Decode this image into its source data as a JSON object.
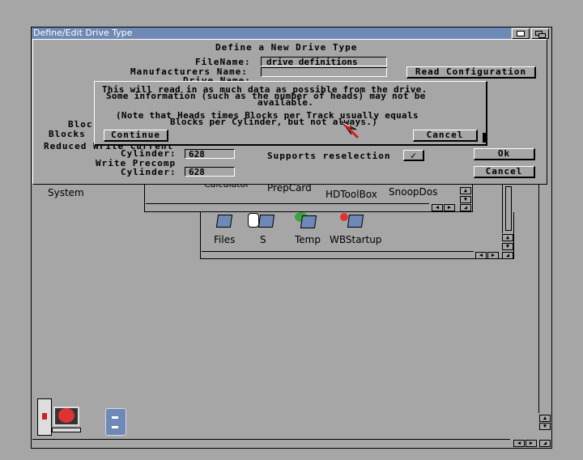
{
  "screen": {
    "window_title": "Define/Edit Drive Type",
    "background_color": "#a6a6a6",
    "titlebar_color": "#6f89b6"
  },
  "workbench": {
    "system_label": "System",
    "back_window_icons": [
      "Calculator",
      "PrepCard",
      "HDToolBox",
      "SnoopDos"
    ],
    "sys_window_icons": [
      "Files",
      "S",
      "Temp",
      "WBStartup"
    ]
  },
  "define_dialog": {
    "title": "Define a New Drive Type",
    "filename_label": "FileName:",
    "filename_value": "drive definitions",
    "manufacturer_label": "Manufacturers Name:",
    "manufacturer_value": "",
    "drive_name_label": "Drive Name:",
    "read_config_button": "Read Configuration",
    "blocks_label_1": "Bloc",
    "blocks_label_2": "Blocks",
    "reduced_label": "Reduced Write Current",
    "reduced_cylinder_label": "Cylinder:",
    "reduced_cylinder_value": "628",
    "precomp_label": "Write Precomp",
    "precomp_cylinder_label": "Cylinder:",
    "precomp_cylinder_value": "628",
    "reselection_label": "Supports reselection",
    "reselection_checked": "✓",
    "ok_button": "Ok",
    "cancel_button": "Cancel"
  },
  "requester": {
    "line1": "This will read in as much data as possible from the drive.",
    "line2": "Some information (such as the number of heads) may not be",
    "line3": "available.",
    "line4": "(Note that Heads times Blocks per Track usually equals",
    "line5": "Blocks per Cylinder, but not always.)",
    "continue_button": "Continue",
    "cancel_button": "Cancel"
  }
}
